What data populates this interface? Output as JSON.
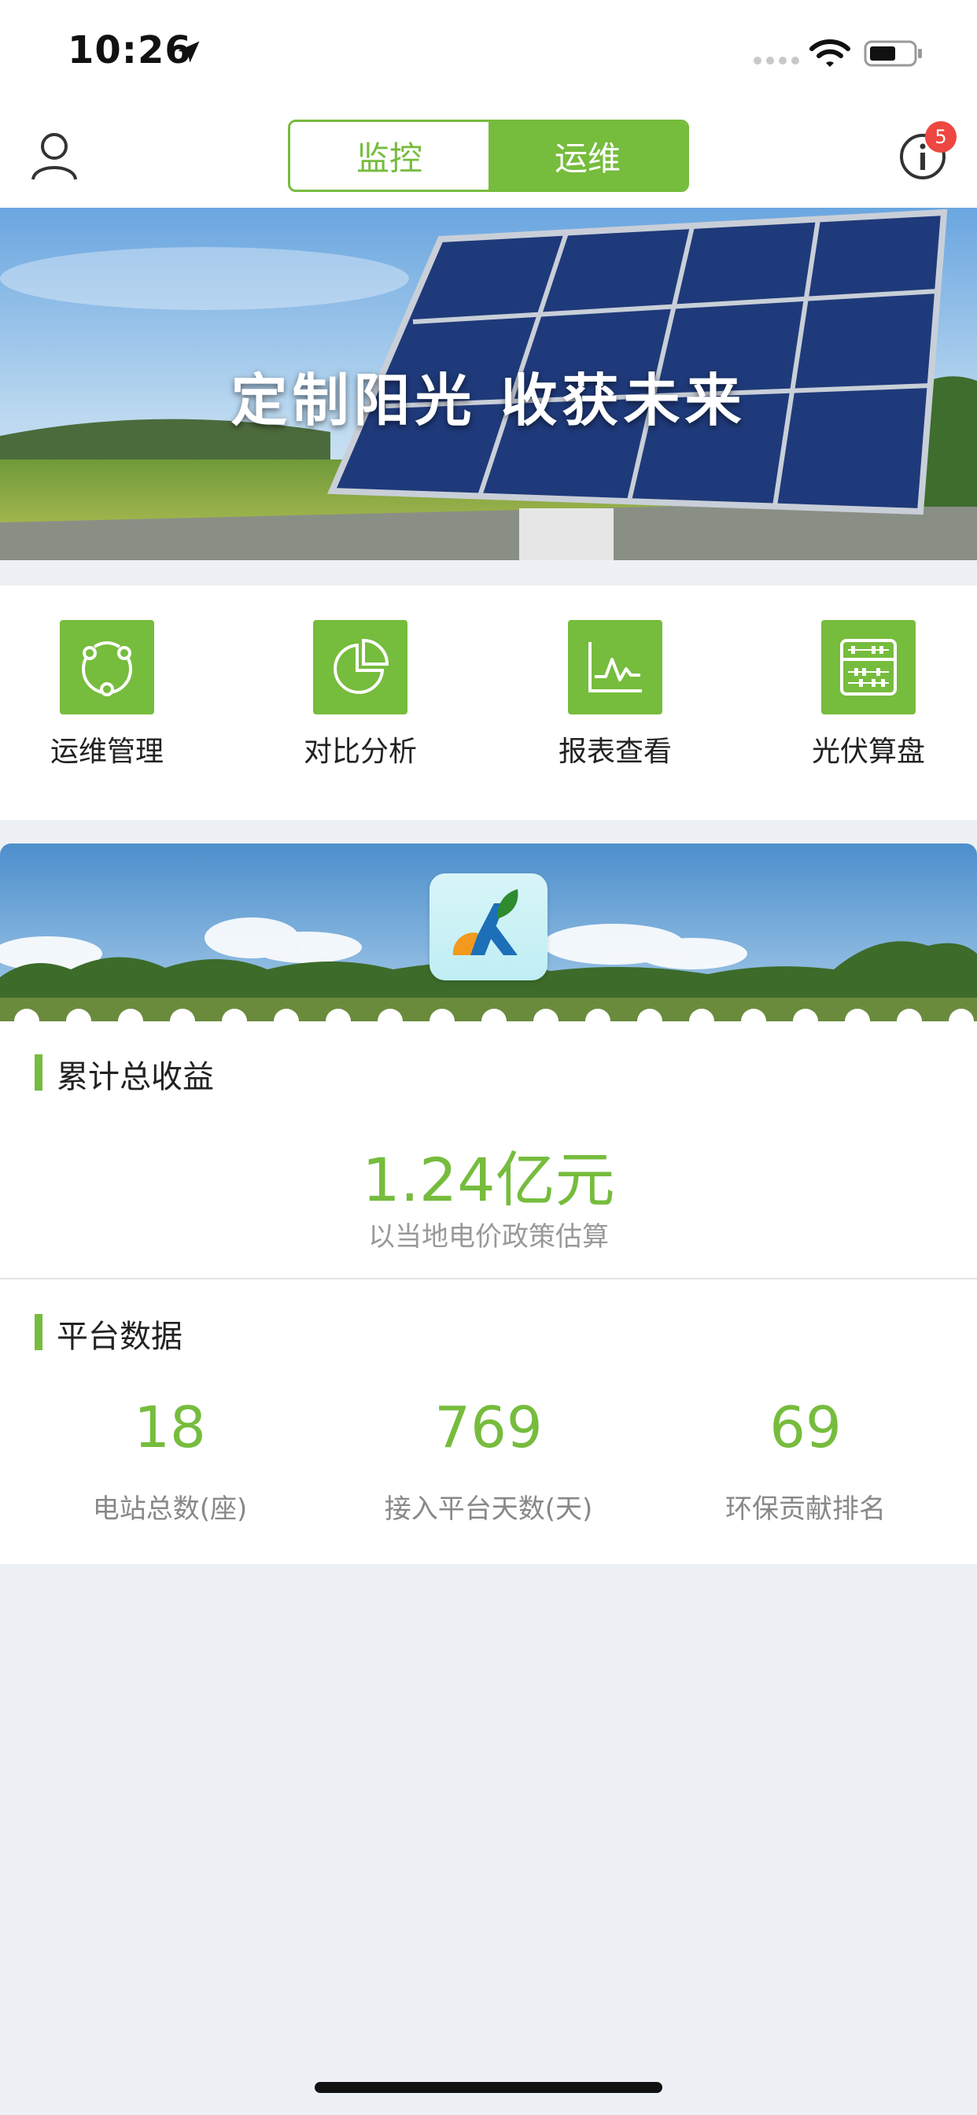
{
  "status_bar": {
    "time": "10:26",
    "icons": [
      "location-arrow-icon",
      "signal-dots-icon",
      "wifi-icon",
      "battery-icon"
    ]
  },
  "header": {
    "tabs": [
      {
        "label": "监控",
        "active": false
      },
      {
        "label": "运维",
        "active": true
      }
    ],
    "notification_count": "5",
    "icons": [
      "user-icon",
      "info-icon"
    ]
  },
  "banner": {
    "slogan": "定制阳光 收获未来"
  },
  "quick_menu": [
    {
      "label": "运维管理",
      "icon": "cycle-icon"
    },
    {
      "label": "对比分析",
      "icon": "pie-chart-icon"
    },
    {
      "label": "报表查看",
      "icon": "line-chart-icon"
    },
    {
      "label": "光伏算盘",
      "icon": "abacus-icon"
    }
  ],
  "revenue": {
    "title": "累计总收益",
    "value": "1.24亿元",
    "note": "以当地电价政策估算"
  },
  "platform": {
    "title": "平台数据",
    "stats": [
      {
        "value": "18",
        "label": "电站总数(座)"
      },
      {
        "value": "769",
        "label": "接入平台天数(天)"
      },
      {
        "value": "69",
        "label": "环保贡献排名"
      }
    ]
  },
  "colors": {
    "accent": "#76bc3d",
    "badge": "#ee4640",
    "background": "#edf0f4"
  }
}
